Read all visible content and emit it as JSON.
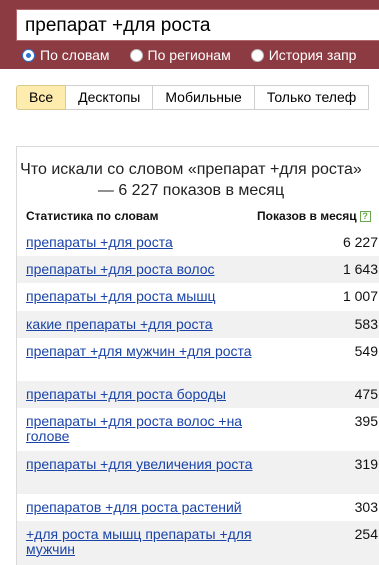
{
  "search": {
    "query": "препарат +для роста"
  },
  "modes": [
    {
      "label": "По словам",
      "selected": true
    },
    {
      "label": "По регионам",
      "selected": false
    },
    {
      "label": "История запр",
      "selected": false
    }
  ],
  "tabs": [
    {
      "label": "Все",
      "active": true
    },
    {
      "label": "Десктопы",
      "active": false
    },
    {
      "label": "Мобильные",
      "active": false
    },
    {
      "label": "Только телеф",
      "active": false
    }
  ],
  "panel": {
    "title": "Что искали со словом «препарат +для роста» — 6 227 показов в месяц",
    "col_phrase": "Статистика по словам",
    "col_count": "Показов в месяц",
    "help_glyph": "?"
  },
  "rows": [
    {
      "phrase": "препараты +для роста",
      "count": "6 227"
    },
    {
      "phrase": "препараты +для роста волос",
      "count": "1 643"
    },
    {
      "phrase": "препараты +для роста мышц",
      "count": "1 007"
    },
    {
      "phrase": "какие препараты +для роста",
      "count": "583"
    },
    {
      "phrase": "препарат +для мужчин +для роста",
      "count": "549"
    },
    {
      "phrase": "препараты +для роста бороды",
      "count": "475"
    },
    {
      "phrase": "препараты +для роста волос +на голове",
      "count": "395"
    },
    {
      "phrase": "препараты +для увеличения роста",
      "count": "319"
    },
    {
      "phrase": "препаратов +для роста растений",
      "count": "303"
    },
    {
      "phrase": "+для роста мышц препараты +для мужчин",
      "count": "254"
    }
  ]
}
